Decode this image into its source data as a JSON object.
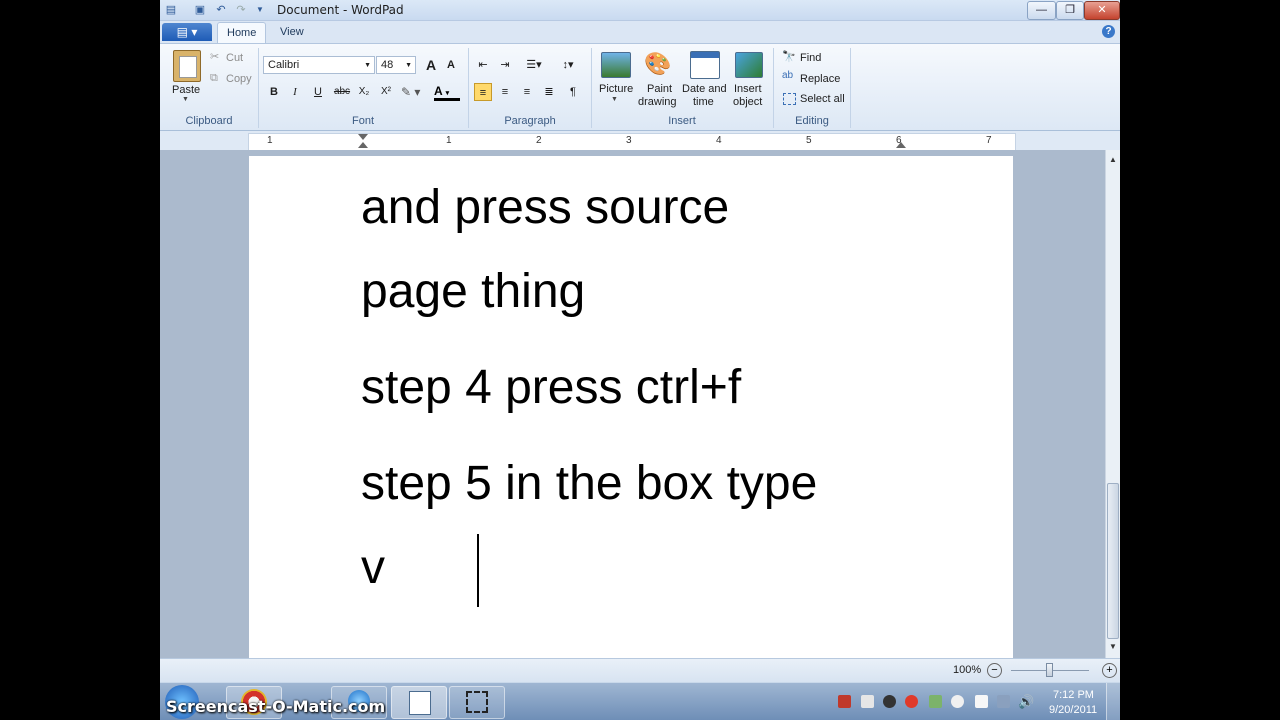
{
  "window": {
    "title": "Document - WordPad",
    "minimize_glyph": "—",
    "restore_glyph": "❐",
    "close_glyph": "✕",
    "help_glyph": "?"
  },
  "tabs": [
    {
      "label": "Home",
      "active": true
    },
    {
      "label": "View",
      "active": false
    }
  ],
  "ribbon": {
    "clipboard": {
      "label": "Clipboard",
      "paste": "Paste",
      "cut": "Cut",
      "copy": "Copy"
    },
    "font": {
      "label": "Font",
      "family": "Calibri",
      "size": "48",
      "bold": "B",
      "italic": "I",
      "underline": "U",
      "strike": "abc",
      "subscript": "X₂",
      "superscript": "X²",
      "grow": "A",
      "shrink": "A",
      "color_glyph": "A"
    },
    "paragraph": {
      "label": "Paragraph"
    },
    "insert": {
      "label": "Insert",
      "picture": "Picture",
      "paint_1": "Paint",
      "paint_2": "drawing",
      "datetime_1": "Date and",
      "datetime_2": "time",
      "object_1": "Insert",
      "object_2": "object"
    },
    "editing": {
      "label": "Editing",
      "find": "Find",
      "replace": "Replace",
      "select_all": "Select all"
    }
  },
  "ruler": {
    "marks": [
      "1",
      "1",
      "2",
      "3",
      "4",
      "5",
      "6",
      "7"
    ]
  },
  "document": {
    "lines": [
      "and press source",
      "page thing",
      "step 4 press ctrl+f",
      "step 5 in the box type",
      "v"
    ]
  },
  "status": {
    "zoom": "100%",
    "zoom_out": "−",
    "zoom_in": "+"
  },
  "taskbar": {
    "time": "7:12 PM",
    "date": "9/20/2011"
  },
  "watermark": "Screencast-O-Matic.com",
  "colors": {
    "accent": "#1e5bb6",
    "ribbon": "#dde8f5",
    "doc_bg": "#abbacd"
  }
}
